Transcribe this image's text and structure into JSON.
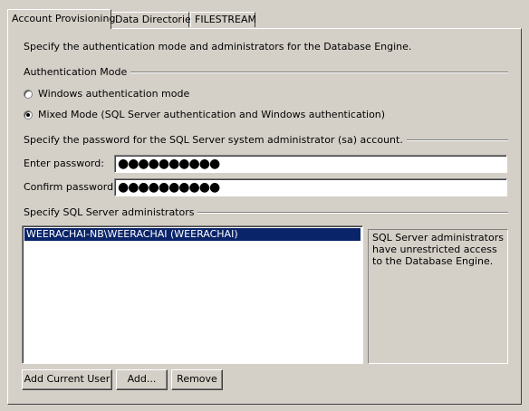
{
  "tabs": [
    {
      "label": "Account Provisioning",
      "active": true
    },
    {
      "label": "Data Directories",
      "active": false
    },
    {
      "label": "FILESTREAM",
      "active": false
    }
  ],
  "intro_text": "Specify the authentication mode and administrators for the Database Engine.",
  "auth_mode": {
    "group_label": "Authentication Mode",
    "options": [
      {
        "label": "Windows authentication mode",
        "checked": false
      },
      {
        "label": "Mixed Mode (SQL Server authentication and Windows authentication)",
        "checked": true
      }
    ]
  },
  "sa_password": {
    "group_label": "Specify the password for the SQL Server system administrator (sa) account.",
    "enter_label": "Enter password:",
    "enter_value": "●●●●●●●●●●",
    "confirm_label": "Confirm password:",
    "confirm_value": "●●●●●●●●●●"
  },
  "administrators": {
    "group_label": "Specify SQL Server administrators",
    "items": [
      "WEERACHAI-NB\\WEERACHAI (WEERACHAI)"
    ],
    "info_text": "SQL Server administrators have unrestricted access to the Database Engine."
  },
  "buttons": {
    "add_current_user": "Add Current User",
    "add": "Add...",
    "remove": "Remove"
  }
}
